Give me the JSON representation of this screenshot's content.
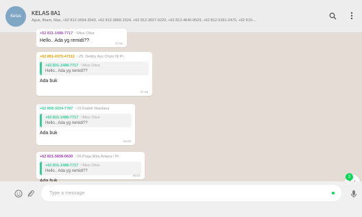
{
  "header": {
    "group_name": "KELAS 8A1",
    "members": "Agus, Ilham, Mas, +62 812-3654-3043, +62 812-3869-1524, +62 812-3927-9220, +62 812-4640-8529, +62 812-5391-2470, +62 819-...",
    "avatar_text": "Kelas"
  },
  "messages": [
    {
      "sender_phone": "+62 831-1488-7717",
      "sender_name": "~Miss Olive",
      "sender_color": "#9b59b6",
      "text": "Hello.. Ada yg remidi??",
      "time": "07:56"
    },
    {
      "sender_phone": "+62 881-0375-47112",
      "sender_name": "~25. Debby Ayu Chyni Ni Pt",
      "sender_color": "#e5a100",
      "quote_phone": "+62 831-1488-7717",
      "quote_name": "~Miss Olive",
      "quote_text": "Hello.. Ada yg remidi??",
      "text": "Ada buk",
      "time": "07:58"
    },
    {
      "sender_phone": "+62 858-3224-7787",
      "sender_name": "~15.Kadek Wardana",
      "sender_color": "#35cd96",
      "quote_phone": "+62 831-1488-7717",
      "quote_name": "~Miss Olive",
      "quote_text": "Hello.. Ada yg remidi??",
      "text": "Ada buk",
      "time": "08:00"
    },
    {
      "sender_phone": "+62 821-5858-0630",
      "sender_name": "~06.Praja Wira Antara / Pt",
      "sender_color": "#a33ab7",
      "quote_phone": "+62 831-1488-7717",
      "quote_name": "~Miss Olive",
      "quote_text": "Hello.. Ada yg remidi??",
      "text": "Ada buk",
      "time": "08:01"
    }
  ],
  "unread_count": "3",
  "composer": {
    "placeholder": "Type a message"
  },
  "colors": {
    "accent": "#06d755",
    "quote_bar": "#35cd96"
  },
  "icons": [
    "search-icon",
    "menu-icon",
    "emoji-icon",
    "attach-icon",
    "mic-icon",
    "chevron-down-icon"
  ]
}
